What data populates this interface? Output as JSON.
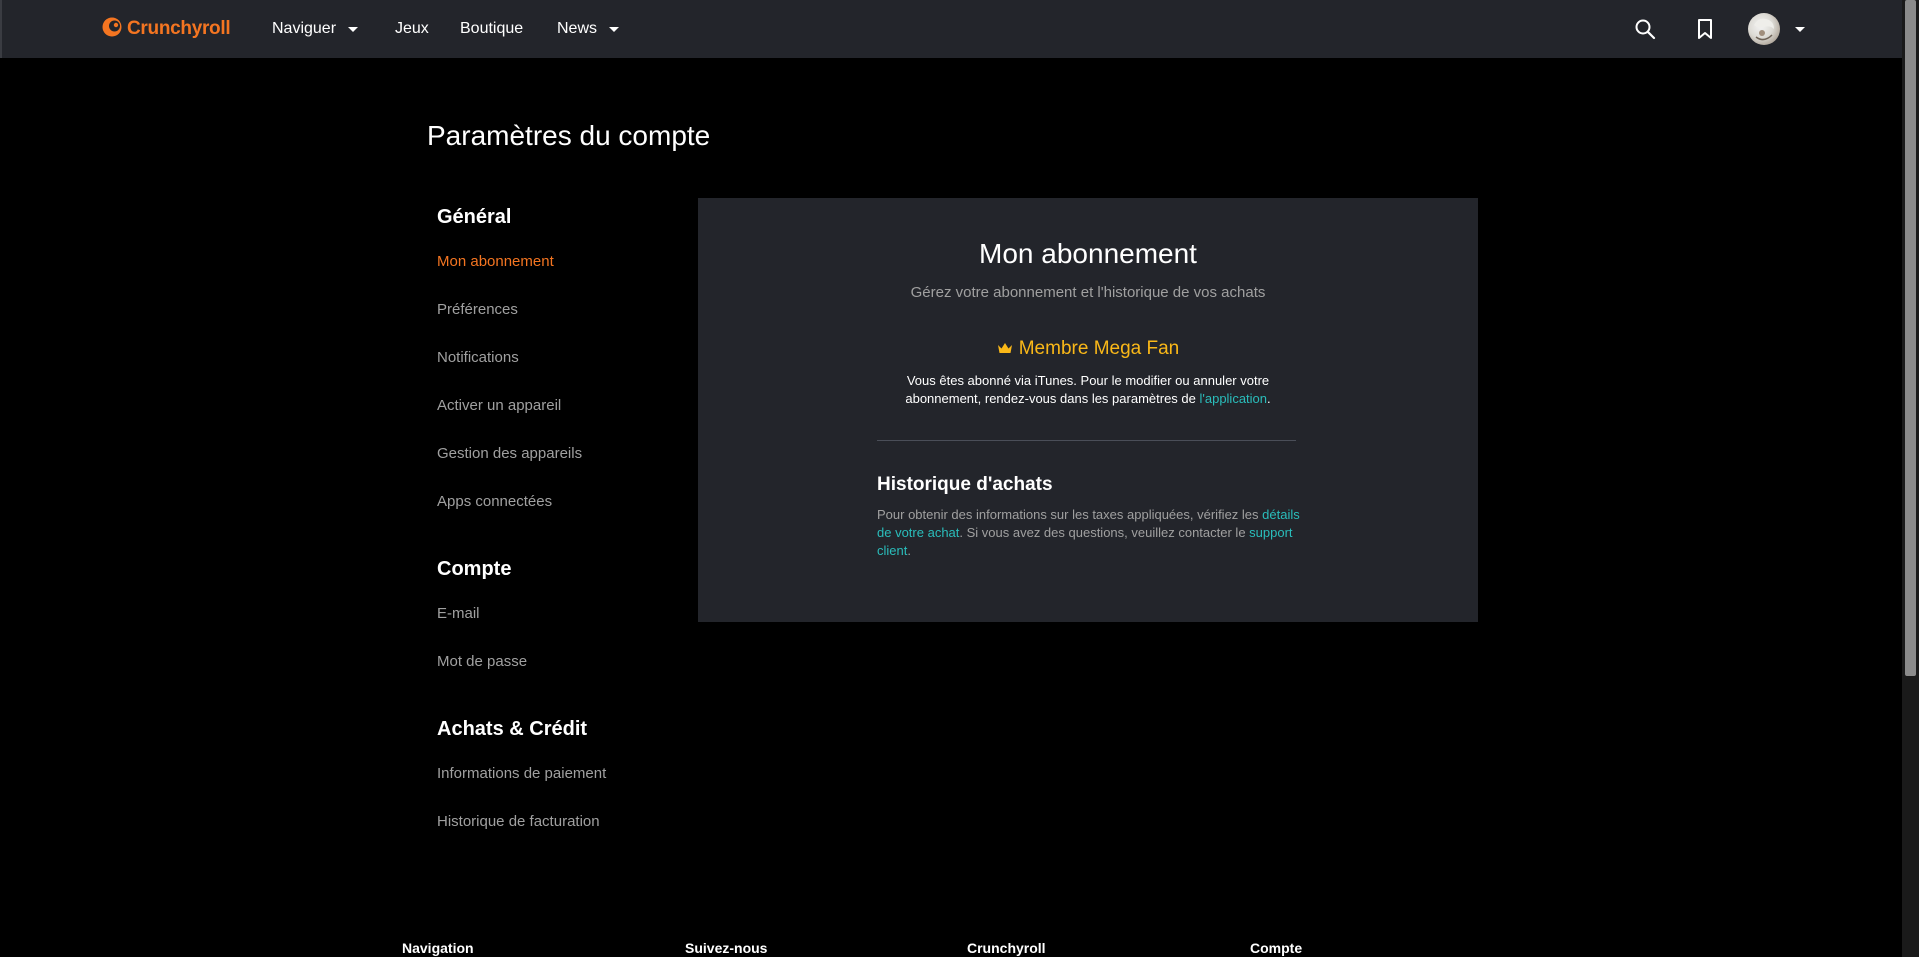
{
  "header": {
    "logo_text": "Crunchyroll",
    "nav": [
      {
        "label": "Naviguer",
        "has_dropdown": true
      },
      {
        "label": "Jeux",
        "has_dropdown": false
      },
      {
        "label": "Boutique",
        "has_dropdown": false
      },
      {
        "label": "News",
        "has_dropdown": true
      }
    ],
    "icons": [
      "search-icon",
      "bookmark-icon",
      "avatar"
    ]
  },
  "page_title": "Paramètres du compte",
  "sidebar": {
    "sections": [
      {
        "heading": "Général",
        "items": [
          "Mon abonnement",
          "Préférences",
          "Notifications",
          "Activer un appareil",
          "Gestion des appareils",
          "Apps connectées"
        ]
      },
      {
        "heading": "Compte",
        "items": [
          "E-mail",
          "Mot de passe"
        ]
      },
      {
        "heading": "Achats & Crédit",
        "items": [
          "Informations de paiement",
          "Historique de facturation"
        ]
      }
    ],
    "active_item": "Mon abonnement"
  },
  "subscription": {
    "title": "Mon abonnement",
    "subtitle": "Gérez votre abonnement et l'historique de vos achats",
    "tier_name": "Membre Mega Fan",
    "info_text": "Vous êtes abonné via iTunes. Pour le modifier ou annuler votre abonnement, rendez-vous dans les paramètres de ",
    "info_link": "l'application",
    "info_end": "."
  },
  "history": {
    "title": "Historique d'achats",
    "text_part1": "Pour obtenir des informations sur les taxes appliquées, vérifiez les ",
    "link1": "détails de votre achat",
    "text_part2": ". Si vous avez des questions, veuillez contacter le ",
    "link2": "support client",
    "text_part3": "."
  },
  "footer": {
    "columns": [
      "Navigation",
      "Suivez-nous",
      "Crunchyroll",
      "Compte"
    ]
  },
  "colors": {
    "accent": "#f47521",
    "tier": "#fab818",
    "link": "#2abdbb",
    "card_bg": "#23252b",
    "header_bg": "#23252b"
  }
}
